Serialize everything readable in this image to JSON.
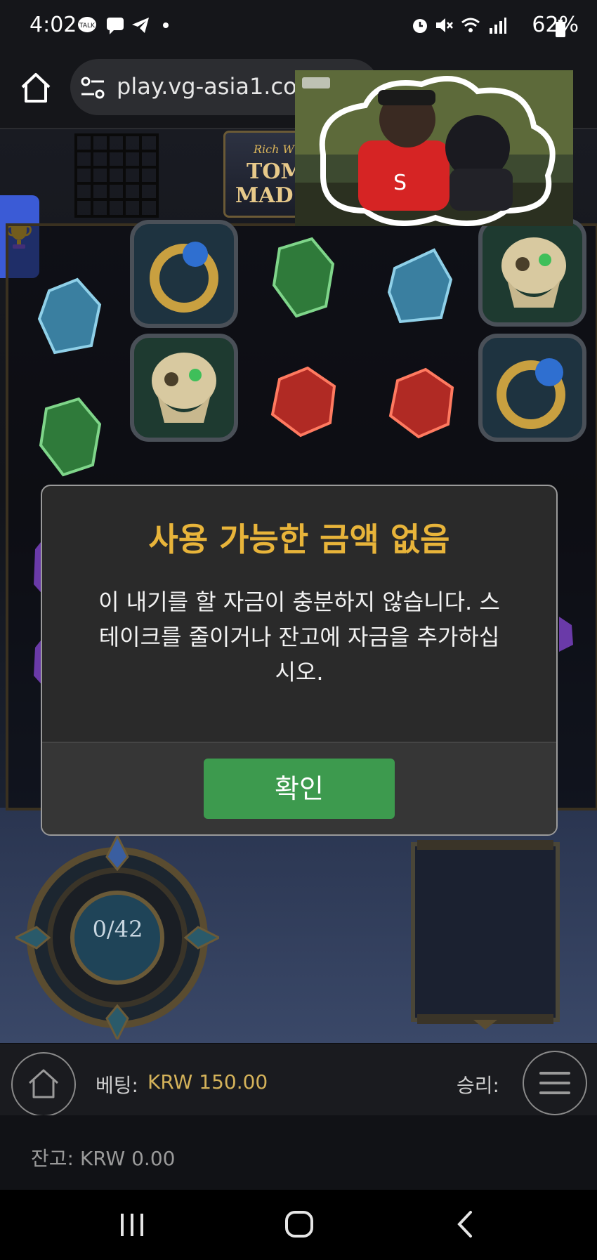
{
  "status_bar": {
    "time": "4:02",
    "battery": "62%",
    "notification_icons": [
      "talk-icon",
      "chat-icon",
      "telegram-icon",
      "dot-icon"
    ],
    "system_icons": [
      "alarm-icon",
      "mute-icon",
      "wifi-icon",
      "signal-icon",
      "battery-icon"
    ]
  },
  "browser": {
    "url": "play.vg-asia1.com"
  },
  "game": {
    "logo_text": [
      "Rich W",
      "TOM",
      "MAD"
    ],
    "counter": "0/42"
  },
  "modal": {
    "title": "사용 가능한 금액 없음",
    "message_line1": "이 내기를 할 자금이 충분하지 않습니다. 스",
    "message_line2": "테이크를 줄이거나 잔고에 자금을 추가하십",
    "message_line3": "시오.",
    "ok_label": "확인"
  },
  "controls": {
    "bet_label": "베팅:",
    "bet_value": "KRW 150.00",
    "win_label": "승리:",
    "balance": "잔고: KRW 0.00"
  },
  "colors": {
    "accent_gold": "#e8b43a",
    "ok_green": "#3d9a4e",
    "bet_gold": "#d4b25a"
  }
}
